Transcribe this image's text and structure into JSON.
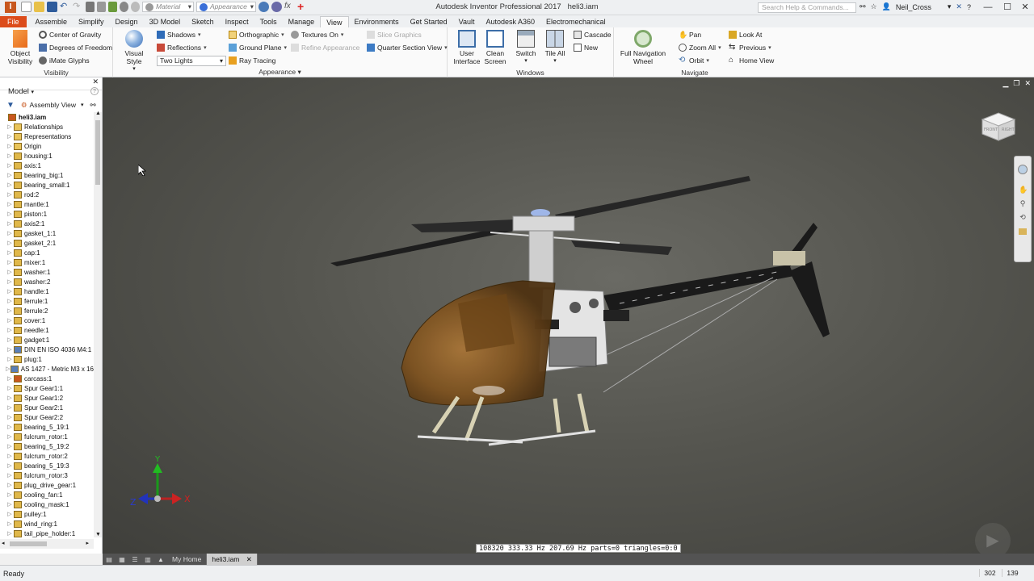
{
  "app": {
    "title": "Autodesk Inventor Professional 2017",
    "document": "heli3.iam",
    "logo_letter": "I"
  },
  "qat": {
    "material_placeholder": "Material",
    "appearance_placeholder": "Appearance"
  },
  "search": {
    "placeholder": "Search Help & Commands..."
  },
  "user": {
    "name": "Neil_Cross"
  },
  "ribbon_tabs": [
    {
      "label": "File",
      "key": "file"
    },
    {
      "label": "Assemble"
    },
    {
      "label": "Simplify"
    },
    {
      "label": "Design"
    },
    {
      "label": "3D Model"
    },
    {
      "label": "Sketch"
    },
    {
      "label": "Inspect"
    },
    {
      "label": "Tools"
    },
    {
      "label": "Manage"
    },
    {
      "label": "View",
      "active": true
    },
    {
      "label": "Environments"
    },
    {
      "label": "Get Started"
    },
    {
      "label": "Vault"
    },
    {
      "label": "Autodesk A360"
    },
    {
      "label": "Electromechanical"
    }
  ],
  "ribbon": {
    "visibility": {
      "title": "Visibility",
      "object_visibility": "Object\nVisibility",
      "object_visibility_l1": "Object",
      "object_visibility_l2": "Visibility",
      "center_of_gravity": "Center of Gravity",
      "degrees_of_freedom": "Degrees of Freedom",
      "imate_glyphs": "iMate Glyphs"
    },
    "appearance": {
      "title": "Appearance",
      "visual_style": "Visual Style",
      "shadows": "Shadows",
      "reflections": "Reflections",
      "lighting": "Two Lights",
      "orthographic": "Orthographic",
      "ground_plane": "Ground Plane",
      "ray_tracing": "Ray Tracing",
      "textures_on": "Textures On",
      "refine_appearance": "Refine Appearance",
      "slice_graphics": "Slice Graphics",
      "quarter_section_view": "Quarter Section View"
    },
    "windows": {
      "title": "Windows",
      "user_interface_l1": "User",
      "user_interface_l2": "Interface",
      "clean_screen_l1": "Clean",
      "clean_screen_l2": "Screen",
      "switch": "Switch",
      "tile_all": "Tile All",
      "cascade": "Cascade",
      "new": "New"
    },
    "navigate": {
      "title": "Navigate",
      "full_nav_l1": "Full Navigation",
      "full_nav_l2": "Wheel",
      "pan": "Pan",
      "zoom_all": "Zoom All",
      "orbit": "Orbit",
      "look_at": "Look At",
      "previous": "Previous",
      "home_view": "Home View"
    }
  },
  "browser": {
    "title": "Model",
    "view": "Assembly View",
    "items": [
      {
        "label": "heli3.iam",
        "root": true
      },
      {
        "label": "Relationships",
        "icon": "folder"
      },
      {
        "label": "Representations",
        "icon": "folder"
      },
      {
        "label": "Origin",
        "icon": "folder"
      },
      {
        "label": "housing:1",
        "icon": "part"
      },
      {
        "label": "axis:1",
        "icon": "part"
      },
      {
        "label": "bearing_big:1",
        "icon": "part"
      },
      {
        "label": "bearing_small:1",
        "icon": "part"
      },
      {
        "label": "rod:2",
        "icon": "part"
      },
      {
        "label": "mantle:1",
        "icon": "part"
      },
      {
        "label": "piston:1",
        "icon": "part"
      },
      {
        "label": "axis2:1",
        "icon": "part"
      },
      {
        "label": "gasket_1:1",
        "icon": "part"
      },
      {
        "label": "gasket_2:1",
        "icon": "part"
      },
      {
        "label": "cap:1",
        "icon": "part"
      },
      {
        "label": "mixer:1",
        "icon": "part"
      },
      {
        "label": "washer:1",
        "icon": "part"
      },
      {
        "label": "washer:2",
        "icon": "part"
      },
      {
        "label": "handle:1",
        "icon": "part"
      },
      {
        "label": "ferrule:1",
        "icon": "part"
      },
      {
        "label": "ferrule:2",
        "icon": "part"
      },
      {
        "label": "cover:1",
        "icon": "part"
      },
      {
        "label": "needle:1",
        "icon": "part"
      },
      {
        "label": "gadget:1",
        "icon": "part"
      },
      {
        "label": "DIN EN ISO 4036 M4:1",
        "icon": "cc"
      },
      {
        "label": "plug:1",
        "icon": "part"
      },
      {
        "label": "AS 1427 - Metric M3 x 16",
        "icon": "cc"
      },
      {
        "label": "carcass:1",
        "icon": "asm"
      },
      {
        "label": "Spur Gear1:1",
        "icon": "part"
      },
      {
        "label": "Spur Gear1:2",
        "icon": "part"
      },
      {
        "label": "Spur Gear2:1",
        "icon": "part"
      },
      {
        "label": "Spur Gear2:2",
        "icon": "part"
      },
      {
        "label": "bearing_5_19:1",
        "icon": "part"
      },
      {
        "label": "fulcrum_rotor:1",
        "icon": "part"
      },
      {
        "label": "bearing_5_19:2",
        "icon": "part"
      },
      {
        "label": "fulcrum_rotor:2",
        "icon": "part"
      },
      {
        "label": "bearing_5_19:3",
        "icon": "part"
      },
      {
        "label": "fulcrum_rotor:3",
        "icon": "part"
      },
      {
        "label": "plug_drive_gear:1",
        "icon": "part"
      },
      {
        "label": "cooling_fan:1",
        "icon": "part"
      },
      {
        "label": "cooling_mask:1",
        "icon": "part"
      },
      {
        "label": "pulley:1",
        "icon": "part"
      },
      {
        "label": "wind_ring:1",
        "icon": "part"
      },
      {
        "label": "tail_pipe_holder:1",
        "icon": "part"
      }
    ]
  },
  "viewport": {
    "stats": "108320 333.33 Hz 207.69 Hz  parts=0 triangles=0:0",
    "viewcube_front": "FRONT",
    "viewcube_right": "RIGHT",
    "axis_x": "X",
    "axis_y": "Y",
    "axis_z": "Z"
  },
  "doc_tabs": {
    "home": "My Home",
    "active": "heli3.iam"
  },
  "status": {
    "text": "Ready",
    "x": "302",
    "y": "139"
  },
  "colors": {
    "file_tab": "#dc4c1b",
    "canopy": "#8a5a24",
    "axis_x": "#cc2222",
    "axis_y": "#22aa22",
    "axis_z": "#2233bb"
  }
}
